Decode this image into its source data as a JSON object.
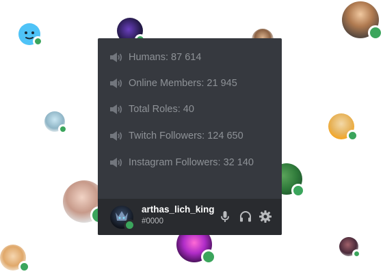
{
  "channels": [
    {
      "label": "Humans: 87 614"
    },
    {
      "label": "Online Members: 21 945"
    },
    {
      "label": "Total Roles: 40"
    },
    {
      "label": "Twitch Followers: 124 650"
    },
    {
      "label": "Instagram Followers: 32 140"
    }
  ],
  "user": {
    "username": "arthas_lich_king",
    "tag": "#0000"
  },
  "controls": {
    "mic_icon": "microphone-icon",
    "headphones_icon": "headphones-icon",
    "settings_icon": "gear-icon"
  },
  "colors": {
    "panel": "#36393f",
    "userbar": "#292b2f",
    "channel_text": "#8e9297",
    "status_online": "#3ba55c"
  }
}
